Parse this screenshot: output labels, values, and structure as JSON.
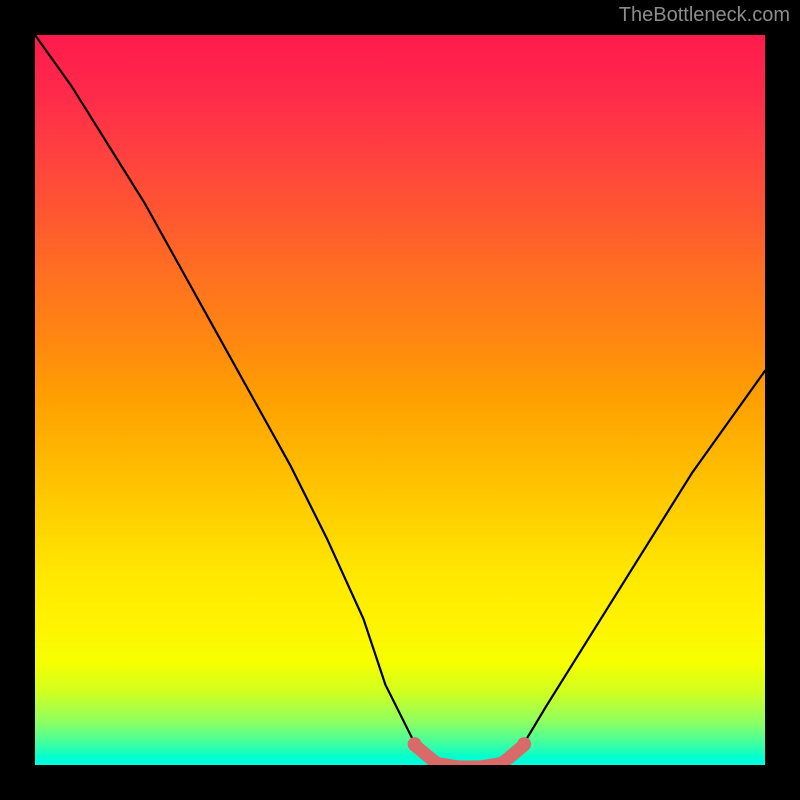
{
  "watermark": "TheBottleneck.com",
  "chart_data": {
    "type": "line",
    "title": "",
    "xlabel": "",
    "ylabel": "",
    "xlim": [
      0,
      100
    ],
    "ylim": [
      0,
      100
    ],
    "series": [
      {
        "name": "bottleneck-curve",
        "x": [
          0,
          5,
          10,
          15,
          20,
          25,
          30,
          35,
          40,
          45,
          48,
          52,
          55,
          58,
          61,
          64,
          67,
          70,
          75,
          80,
          85,
          90,
          95,
          100
        ],
        "values": [
          100,
          93,
          85,
          77,
          68,
          59,
          50,
          41,
          31,
          20,
          11,
          3,
          0.5,
          0,
          0,
          0.5,
          3,
          8,
          16,
          24,
          32,
          40,
          47,
          54
        ]
      }
    ],
    "marker_band": {
      "start_x": 52,
      "end_x": 67,
      "color": "#d96a6a"
    },
    "gradient_stops": [
      {
        "pos": 0,
        "color": "#ff1a4c"
      },
      {
        "pos": 50,
        "color": "#ffd000"
      },
      {
        "pos": 100,
        "color": "#00ffe0"
      }
    ]
  }
}
